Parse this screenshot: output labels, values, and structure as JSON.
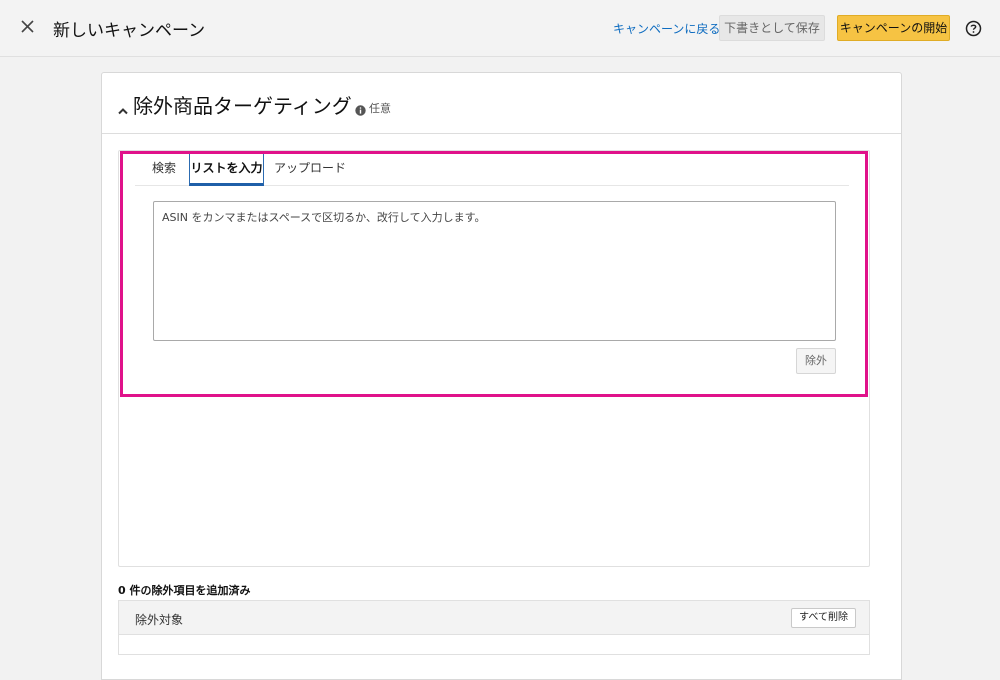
{
  "header": {
    "title": "新しいキャンペーン",
    "back_link": "キャンペーンに戻る",
    "save_draft": "下書きとして保存",
    "start_campaign": "キャンペーンの開始"
  },
  "section": {
    "title": "除外商品ターゲティング",
    "optional_label": "任意"
  },
  "tabs": [
    {
      "label": "検索",
      "active": false
    },
    {
      "label": "リストを入力",
      "active": true
    },
    {
      "label": "アップロード",
      "active": false
    }
  ],
  "list_input": {
    "placeholder": "ASIN をカンマまたはスペースで区切るか、改行して入力します。",
    "value": "",
    "exclude_button": "除外"
  },
  "excluded": {
    "count_text": "0 件の除外項目を追加済み",
    "column_header": "除外対象",
    "delete_all_button": "すべて削除"
  },
  "colors": {
    "accent_link": "#0e6cc0",
    "primary_button": "#f6c343",
    "highlight_border": "#e0128a",
    "active_tab": "#2c6bb1"
  },
  "icons": [
    "close-icon",
    "help-icon",
    "chevron-up-icon",
    "info-icon"
  ]
}
